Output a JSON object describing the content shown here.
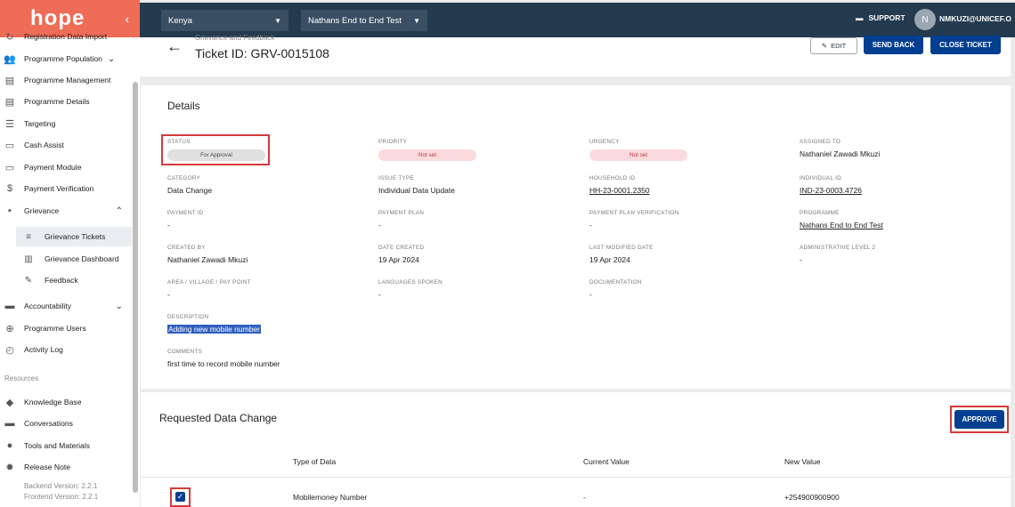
{
  "sidebar": {
    "logo": "hope",
    "items": [
      {
        "label": "Registration Data Import",
        "icon": "registration-icon"
      },
      {
        "label": "Programme Population",
        "icon": "people-icon"
      },
      {
        "label": "Programme Management",
        "icon": "clipboard-icon"
      },
      {
        "label": "Programme Details",
        "icon": "clipboard-icon"
      },
      {
        "label": "Targeting",
        "icon": "list-icon"
      },
      {
        "label": "Cash Assist",
        "icon": "card-icon"
      },
      {
        "label": "Payment Module",
        "icon": "card-icon"
      },
      {
        "label": "Payment Verification",
        "icon": "dollar-icon"
      },
      {
        "label": "Grievance",
        "icon": "grievance-icon"
      },
      {
        "label": "Grievance Tickets",
        "icon": "list-lines-icon"
      },
      {
        "label": "Grievance Dashboard",
        "icon": "chart-icon"
      },
      {
        "label": "Feedback",
        "icon": "feedback-icon"
      },
      {
        "label": "Accountability",
        "icon": "chat-icon"
      },
      {
        "label": "Programme Users",
        "icon": "globe-icon"
      },
      {
        "label": "Activity Log",
        "icon": "history-icon"
      }
    ],
    "resources_label": "Resources",
    "resources": [
      {
        "label": "Knowledge Base",
        "icon": "knowledge-icon"
      },
      {
        "label": "Conversations",
        "icon": "chat-icon"
      },
      {
        "label": "Tools and Materials",
        "icon": "info-icon"
      },
      {
        "label": "Release Note",
        "icon": "gear-icon"
      }
    ],
    "backend_version": "Backend Version: 2.2.1",
    "frontend_version": "Frontend Version: 2.2.1"
  },
  "topbar": {
    "country": "Kenya",
    "programme": "Nathans End to End Test",
    "support": "SUPPORT",
    "avatar_initial": "N",
    "username": "NMKUZI@UNICEF.O"
  },
  "header": {
    "breadcrumb": "Grievance and Feedback",
    "title": "Ticket ID: GRV-0015108",
    "edit": "EDIT",
    "send_back": "SEND BACK",
    "close_ticket": "CLOSE TICKET"
  },
  "details": {
    "title": "Details",
    "status_label": "STATUS",
    "status": "For Approval",
    "priority_label": "PRIORITY",
    "priority": "Not set",
    "urgency_label": "URGENCY",
    "urgency": "Not set",
    "assigned_label": "ASSIGNED TO",
    "assigned": "Nathaniel Zawadi Mkuzi",
    "category_label": "CATEGORY",
    "category": "Data Change",
    "issue_label": "ISSUE TYPE",
    "issue": "Individual Data Update",
    "household_label": "HOUSEHOLD ID",
    "household": "HH-23-0001.2350",
    "individual_label": "INDIVIDUAL ID",
    "individual": "IND-23-0003.4726",
    "payment_id_label": "PAYMENT ID",
    "payment_id": "-",
    "payment_plan_label": "PAYMENT PLAN",
    "payment_plan": "-",
    "ppv_label": "PAYMENT PLAN VERIFICATION",
    "ppv": "-",
    "programme_label": "PROGRAMME",
    "programme": "Nathans End to End Test",
    "created_by_label": "CREATED BY",
    "created_by": "Nathaniel Zawadi Mkuzi",
    "date_created_label": "DATE CREATED",
    "date_created": "19 Apr 2024",
    "last_modified_label": "LAST MODIFIED DATE",
    "last_modified": "19 Apr 2024",
    "admin2_label": "ADMINISTRATIVE LEVEL 2",
    "admin2": "-",
    "area_label": "AREA / VILLAGE / PAY POINT",
    "area": "-",
    "languages_label": "LANGUAGES SPOKEN",
    "languages": "-",
    "documentation_label": "DOCUMENTATION",
    "documentation": "-",
    "description_label": "DESCRIPTION",
    "description": "Adding new mobile number",
    "comments_label": "COMMENTS",
    "comments": "first time to record mobile number"
  },
  "data_change": {
    "title": "Requested Data Change",
    "approve": "APPROVE",
    "columns": [
      "Type of Data",
      "Current Value",
      "New Value"
    ],
    "rows": [
      {
        "checked": true,
        "type": "Mobilemoney Number",
        "current": "-",
        "new": "+254900900900"
      }
    ]
  },
  "colors": {
    "topbar": "#243a4e",
    "logo_bg": "#ef6c57",
    "primary": "#033f91",
    "highlight": "#d53a3a"
  }
}
